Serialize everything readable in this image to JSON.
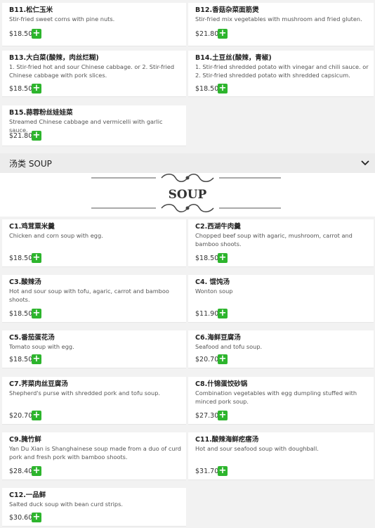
{
  "section": {
    "title": "汤类 SOUP",
    "banner_text": "SOUP"
  },
  "add_symbol": "+",
  "top_items": [
    {
      "code_name": "B11.松仁玉米",
      "desc": "Stir-fried sweet corns with pine nuts.",
      "price": "$18.50"
    },
    {
      "code_name": "B12.香菇杂菜面筋煲",
      "desc": "Stir-fried mix vegetables with mushroom and fried gluten.",
      "price": "$21.80"
    },
    {
      "code_name": "B13.大白菜(酸辣，肉丝烂糊)",
      "desc": "1. Stir-fried hot and sour Chinese cabbage. or 2. Stir-fried Chinese cabbage with pork slices.",
      "price": "$18.50"
    },
    {
      "code_name": "B14.土豆丝(酸辣，青椒)",
      "desc": "1. Stir-fried shredded potato with vinegar and chili sauce. or 2. Stir-fried shredded potato with shredded capsicum.",
      "price": "$18.50"
    },
    {
      "code_name": "B15.蒜蓉粉丝娃娃菜",
      "desc": "Streamed Chinese cabbage and vermicelli with garlic sauce.",
      "price": "$21.80"
    }
  ],
  "soup_items": [
    {
      "code_name": "C1.鸡茸粟米羹",
      "desc": "Chicken and corn soup with egg.",
      "price": "$18.50"
    },
    {
      "code_name": "C2.西湖牛肉羹",
      "desc": "Chopped beef soup with agaric, mushroom, carrot and bamboo shoots.",
      "price": "$18.50"
    },
    {
      "code_name": "C3.酸辣汤",
      "desc": "Hot and sour soup with tofu, agaric, carrot and bamboo shoots.",
      "price": "$18.50"
    },
    {
      "code_name": "C4. 馄饨汤",
      "desc": "Wonton soup",
      "price": "$11.90"
    },
    {
      "code_name": "C5.番茄蛋花汤",
      "desc": "Tomato soup with egg.",
      "price": "$18.50"
    },
    {
      "code_name": "C6.海鲜豆腐汤",
      "desc": "Seafood and tofu soup.",
      "price": "$20.70"
    },
    {
      "code_name": "C7.荠菜肉丝豆腐汤",
      "desc": "Shepherd's purse with shredded pork and tofu soup.",
      "price": "$20.70"
    },
    {
      "code_name": "C8.什锦蛋饺砂锅",
      "desc": "Combination vegetables with egg dumpling stuffed with minced pork soup.",
      "price": "$27.30"
    },
    {
      "code_name": "C9.腌竹鲜",
      "desc": "Yan Du Xian is Shanghainese soup made from a duo of curd pork and fresh pork with bamboo shoots.",
      "price": "$28.40"
    },
    {
      "code_name": "C11.酸辣海鲜疙瘩汤",
      "desc": "Hot and sour seafood soup with doughball.",
      "price": "$31.70"
    },
    {
      "code_name": "C12.一品鲜",
      "desc": "Salted duck soup with bean curd strips.",
      "price": "$30.60"
    }
  ]
}
